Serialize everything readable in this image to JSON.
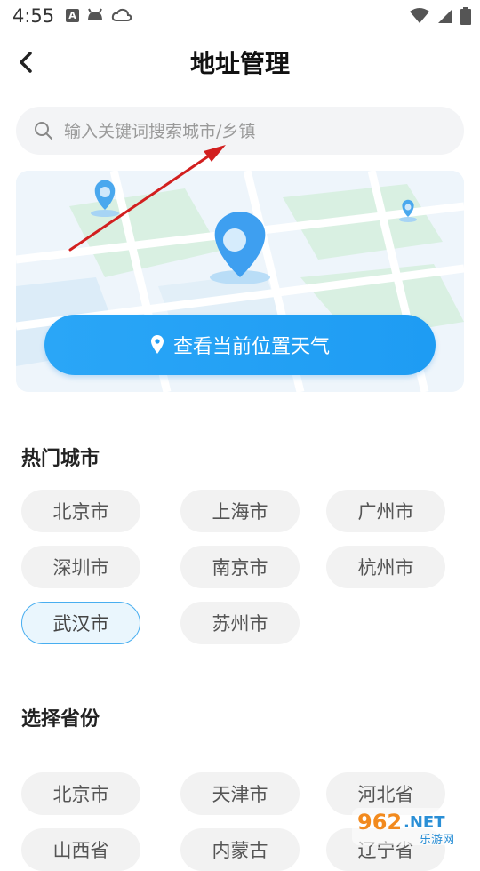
{
  "status_bar": {
    "time": "4:55",
    "a_icon": "A"
  },
  "header": {
    "title": "地址管理"
  },
  "search": {
    "placeholder": "输入关键词搜索城市/乡镇"
  },
  "locate": {
    "label": "查看当前位置天气"
  },
  "hot_cities": {
    "title": "热门城市",
    "items": [
      "北京市",
      "上海市",
      "广州市",
      "深圳市",
      "南京市",
      "杭州市",
      "武汉市",
      "苏州市"
    ],
    "selected": "武汉市"
  },
  "provinces": {
    "title": "选择省份",
    "items": [
      "北京市",
      "天津市",
      "河北省",
      "山西省",
      "内蒙古",
      "辽宁省"
    ]
  },
  "watermark": {
    "text_main": "962",
    "text_suffix": ".NET",
    "text_sub": "乐游网"
  },
  "colors": {
    "accent": "#1e9cf3",
    "chip_bg": "#f2f2f2",
    "selected_border": "#48aef0",
    "arrow": "#d21f1f"
  }
}
